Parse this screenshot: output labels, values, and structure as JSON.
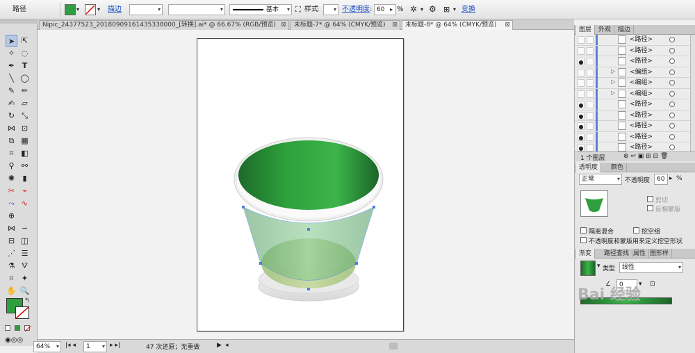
{
  "control_bar": {
    "object_type": "路径",
    "stroke_label": "描边",
    "stroke_weight": "",
    "brush_label": "基本",
    "style_label": "样式",
    "opacity_label": "不透明度",
    "opacity_value": "60",
    "opacity_unit": "%",
    "transform_label": "变换",
    "fill_color": "#2e9e3e"
  },
  "tabs": [
    {
      "label": "Nipic_24377523_20180909161435338000_[转换].ai* @ 66.67% (RGB/预览)",
      "close": "⊠"
    },
    {
      "label": "未标题-7* @ 64% (CMYK/预览)",
      "close": "⊠"
    },
    {
      "label": "未标题-8* @ 64% (CMYK/预览)",
      "close": "⊠"
    }
  ],
  "status": {
    "zoom": "64%",
    "page": "1",
    "history": "47 次还原；无重做"
  },
  "layers_panel": {
    "tabs": [
      "图层",
      "外观",
      "描边"
    ],
    "rows": [
      {
        "name": "<路径>",
        "eye": ""
      },
      {
        "name": "<路径>",
        "eye": ""
      },
      {
        "name": "<路径>",
        "eye": "●"
      },
      {
        "name": "<编组>",
        "eye": ""
      },
      {
        "name": "<编组>",
        "eye": ""
      },
      {
        "name": "<编组>",
        "eye": ""
      },
      {
        "name": "<路径>",
        "eye": "●"
      },
      {
        "name": "<路径>",
        "eye": "●"
      },
      {
        "name": "<路径>",
        "eye": "●"
      },
      {
        "name": "<路径>",
        "eye": "●"
      },
      {
        "name": "<路径>",
        "eye": "●"
      }
    ],
    "footer": "1 个图层"
  },
  "transparency_panel": {
    "tabs": [
      "透明度",
      "颜色"
    ],
    "mode": "正常",
    "opacity_label": "不透明度",
    "opacity_value": "60",
    "unit": "%",
    "clip_label": "剪切",
    "invert_label": "反相蒙版",
    "isolate_label": "隔离混合",
    "knockout_label": "挖空组",
    "define_knockout_label": "不透明度和蒙版用来定义挖空形状"
  },
  "gradient_panel": {
    "tabs": [
      "渐变",
      "路径查找",
      "属性",
      "图形样"
    ],
    "type_label": "类型",
    "type_value": "线性",
    "angle_value": "0"
  },
  "watermark": "Bai 经验"
}
